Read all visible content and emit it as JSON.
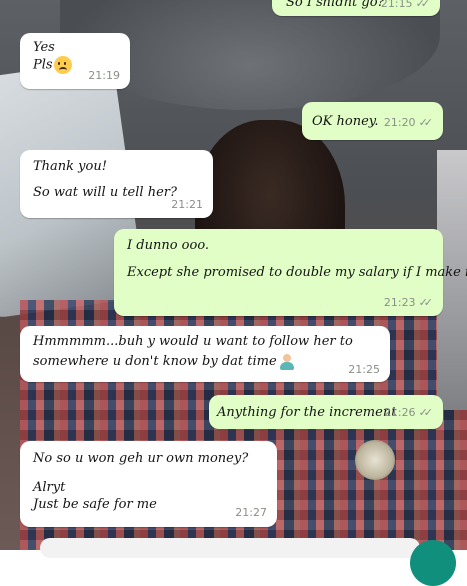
{
  "messages": [
    {
      "id": "m0",
      "direction": "out",
      "lines": [
        "So I shldnt go?"
      ],
      "time": "21:15",
      "ticks": "✓✓"
    },
    {
      "id": "m1",
      "direction": "in",
      "lines": [
        "Yes",
        "Pls"
      ],
      "emoji": "disappointed-face",
      "time": "21:19"
    },
    {
      "id": "m2",
      "direction": "out",
      "lines": [
        "OK honey."
      ],
      "time": "21:20",
      "ticks": "✓✓"
    },
    {
      "id": "m3",
      "direction": "in",
      "lines": [
        "Thank you!",
        "So wat will u tell her?"
      ],
      "time": "21:21"
    },
    {
      "id": "m4",
      "direction": "out",
      "lines": [
        "I dunno ooo.",
        "",
        "Except she promised to double my salary if I make it"
      ],
      "time": "21:23",
      "ticks": "✓✓"
    },
    {
      "id": "m5",
      "direction": "in",
      "lines": [
        "Hmmmmm...buh y would u want to follow her to",
        "somewhere u don't know by dat time"
      ],
      "emoji": "shrug",
      "time": "21:25"
    },
    {
      "id": "m6",
      "direction": "out",
      "lines": [
        "Anything for the increment"
      ],
      "time": "21:26",
      "ticks": "✓✓"
    },
    {
      "id": "m7",
      "direction": "in",
      "lines": [
        "No so u won geh ur own money?",
        "",
        "Alryt",
        "Just be safe for me"
      ],
      "time": "21:27"
    }
  ],
  "colors": {
    "incoming": "#ffffff",
    "outgoing": "#e1fec6",
    "meta": "#8a8f87",
    "send_button": "#0f8f7c"
  }
}
